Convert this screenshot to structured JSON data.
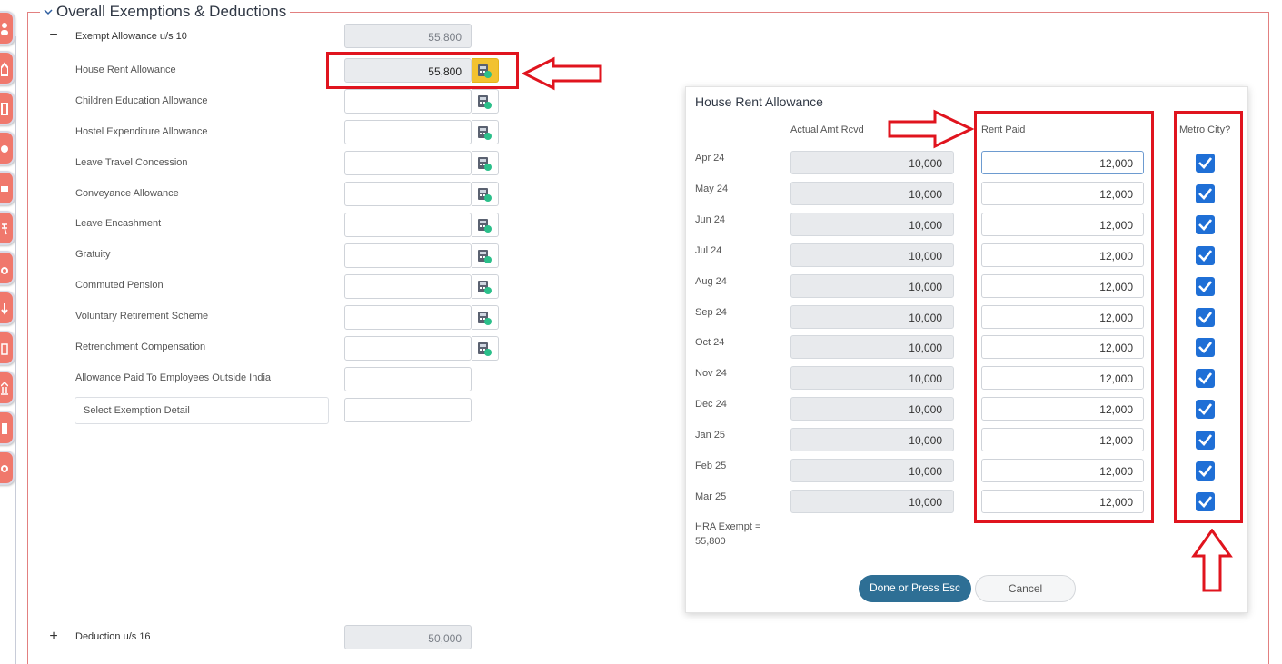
{
  "section": {
    "title": "Overall Exemptions & Deductions",
    "exempt_allowance": {
      "label": "Exempt Allowance u/s 10",
      "toggle": "−",
      "value": "55,800"
    },
    "allowances": [
      {
        "label": "House Rent Allowance",
        "value": "55,800"
      },
      {
        "label": "Children Education Allowance",
        "value": ""
      },
      {
        "label": "Hostel Expenditure Allowance",
        "value": ""
      },
      {
        "label": "Leave Travel Concession",
        "value": ""
      },
      {
        "label": "Conveyance Allowance",
        "value": ""
      },
      {
        "label": "Leave Encashment",
        "value": ""
      },
      {
        "label": "Gratuity",
        "value": ""
      },
      {
        "label": "Commuted Pension",
        "value": ""
      },
      {
        "label": "Voluntary Retirement Scheme",
        "value": ""
      },
      {
        "label": "Retrenchment Compensation",
        "value": ""
      },
      {
        "label": "Allowance Paid To Employees Outside India",
        "value": ""
      }
    ],
    "select_exemption": {
      "placeholder": "Select Exemption Detail",
      "value": ""
    },
    "deduction": {
      "label": "Deduction u/s 16",
      "toggle": "+",
      "value": "50,000"
    }
  },
  "dialog": {
    "title": "House Rent Allowance",
    "col_actual": "Actual Amt Rcvd",
    "col_rent": "Rent Paid",
    "col_metro": "Metro City?",
    "rows": [
      {
        "month": "Apr 24",
        "actual": "10,000",
        "rent": "12,000",
        "metro": true
      },
      {
        "month": "May 24",
        "actual": "10,000",
        "rent": "12,000",
        "metro": true
      },
      {
        "month": "Jun 24",
        "actual": "10,000",
        "rent": "12,000",
        "metro": true
      },
      {
        "month": "Jul 24",
        "actual": "10,000",
        "rent": "12,000",
        "metro": true
      },
      {
        "month": "Aug 24",
        "actual": "10,000",
        "rent": "12,000",
        "metro": true
      },
      {
        "month": "Sep 24",
        "actual": "10,000",
        "rent": "12,000",
        "metro": true
      },
      {
        "month": "Oct 24",
        "actual": "10,000",
        "rent": "12,000",
        "metro": true
      },
      {
        "month": "Nov 24",
        "actual": "10,000",
        "rent": "12,000",
        "metro": true
      },
      {
        "month": "Dec 24",
        "actual": "10,000",
        "rent": "12,000",
        "metro": true
      },
      {
        "month": "Jan 25",
        "actual": "10,000",
        "rent": "12,000",
        "metro": true
      },
      {
        "month": "Feb 25",
        "actual": "10,000",
        "rent": "12,000",
        "metro": true
      },
      {
        "month": "Mar 25",
        "actual": "10,000",
        "rent": "12,000",
        "metro": true
      }
    ],
    "hra_label": "HRA Exempt =",
    "hra_value": "55,800",
    "done_label": "Done or Press Esc",
    "cancel_label": "Cancel"
  },
  "colors": {
    "annotation_red": "#e0141e",
    "done_button": "#2e6f95",
    "checkbox_blue": "#1f6fd6",
    "calc_active": "#f2c230",
    "rail_tab": "#f0786c"
  }
}
